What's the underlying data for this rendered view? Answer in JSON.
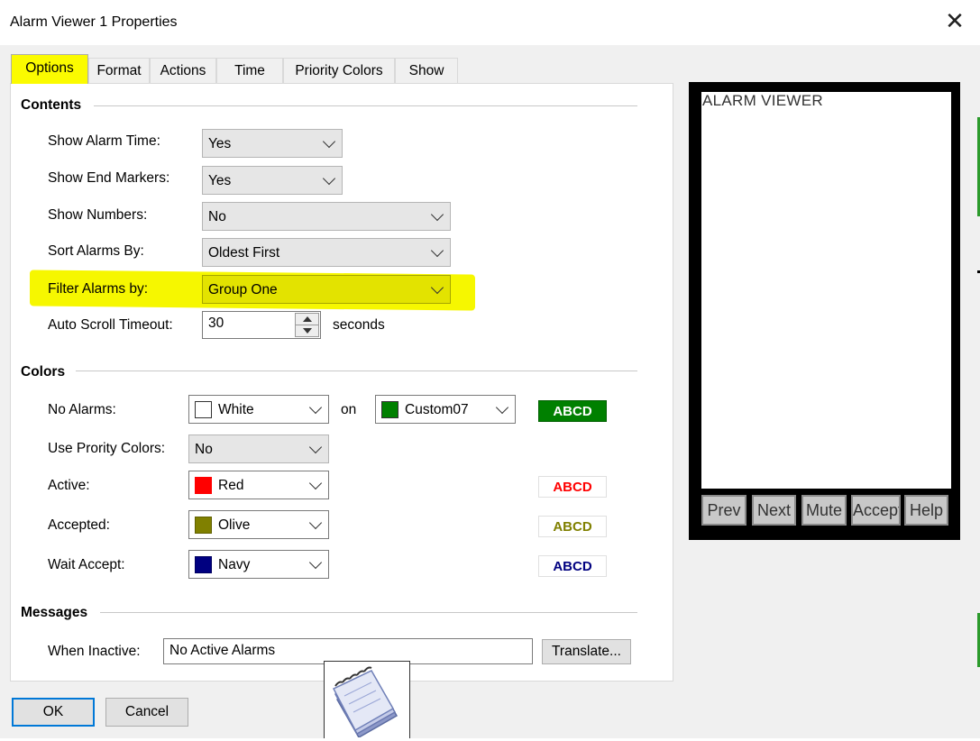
{
  "window": {
    "title": "Alarm Viewer 1 Properties",
    "close_label": "✕"
  },
  "tabs": [
    {
      "label": "Options"
    },
    {
      "label": "Format"
    },
    {
      "label": "Actions"
    },
    {
      "label": "Time"
    },
    {
      "label": "Priority Colors"
    },
    {
      "label": "Show"
    }
  ],
  "contents": {
    "title": "Contents",
    "show_alarm_time": {
      "label": "Show Alarm Time:",
      "value": "Yes"
    },
    "show_end_markers": {
      "label": "Show End Markers:",
      "value": "Yes"
    },
    "show_numbers": {
      "label": "Show Numbers:",
      "value": "No"
    },
    "sort_alarms_by": {
      "label": "Sort Alarms By:",
      "value": "Oldest First"
    },
    "filter_alarms_by": {
      "label": "Filter Alarms by:",
      "value": "Group One"
    },
    "auto_scroll_timeout": {
      "label": "Auto Scroll Timeout:",
      "value": "30",
      "unit": "seconds"
    }
  },
  "colors": {
    "title": "Colors",
    "no_alarms": {
      "label": "No Alarms:",
      "fg": "White",
      "fg_hex": "#ffffff",
      "on_label": "on",
      "bg": "Custom07",
      "bg_hex": "#008000",
      "sample": "ABCD"
    },
    "use_priority_colors": {
      "label": "Use Prority Colors:",
      "value": "No"
    },
    "active": {
      "label": "Active:",
      "value": "Red",
      "hex": "#ff0000",
      "sample": "ABCD"
    },
    "accepted": {
      "label": "Accepted:",
      "value": "Olive",
      "hex": "#808000",
      "sample": "ABCD"
    },
    "wait_accept": {
      "label": "Wait Accept:",
      "value": "Navy",
      "hex": "#000080",
      "sample": "ABCD"
    }
  },
  "messages": {
    "title": "Messages",
    "when_inactive": {
      "label": "When Inactive:",
      "value": "No Active Alarms"
    },
    "translate_label": "Translate..."
  },
  "preview": {
    "title": "ALARM VIEWER",
    "buttons": [
      "Prev",
      "Next",
      "Mute",
      "Accept",
      "Help"
    ]
  },
  "footer": {
    "ok_label": "OK",
    "cancel_label": "Cancel"
  },
  "highlight_color": "#fbfb00"
}
